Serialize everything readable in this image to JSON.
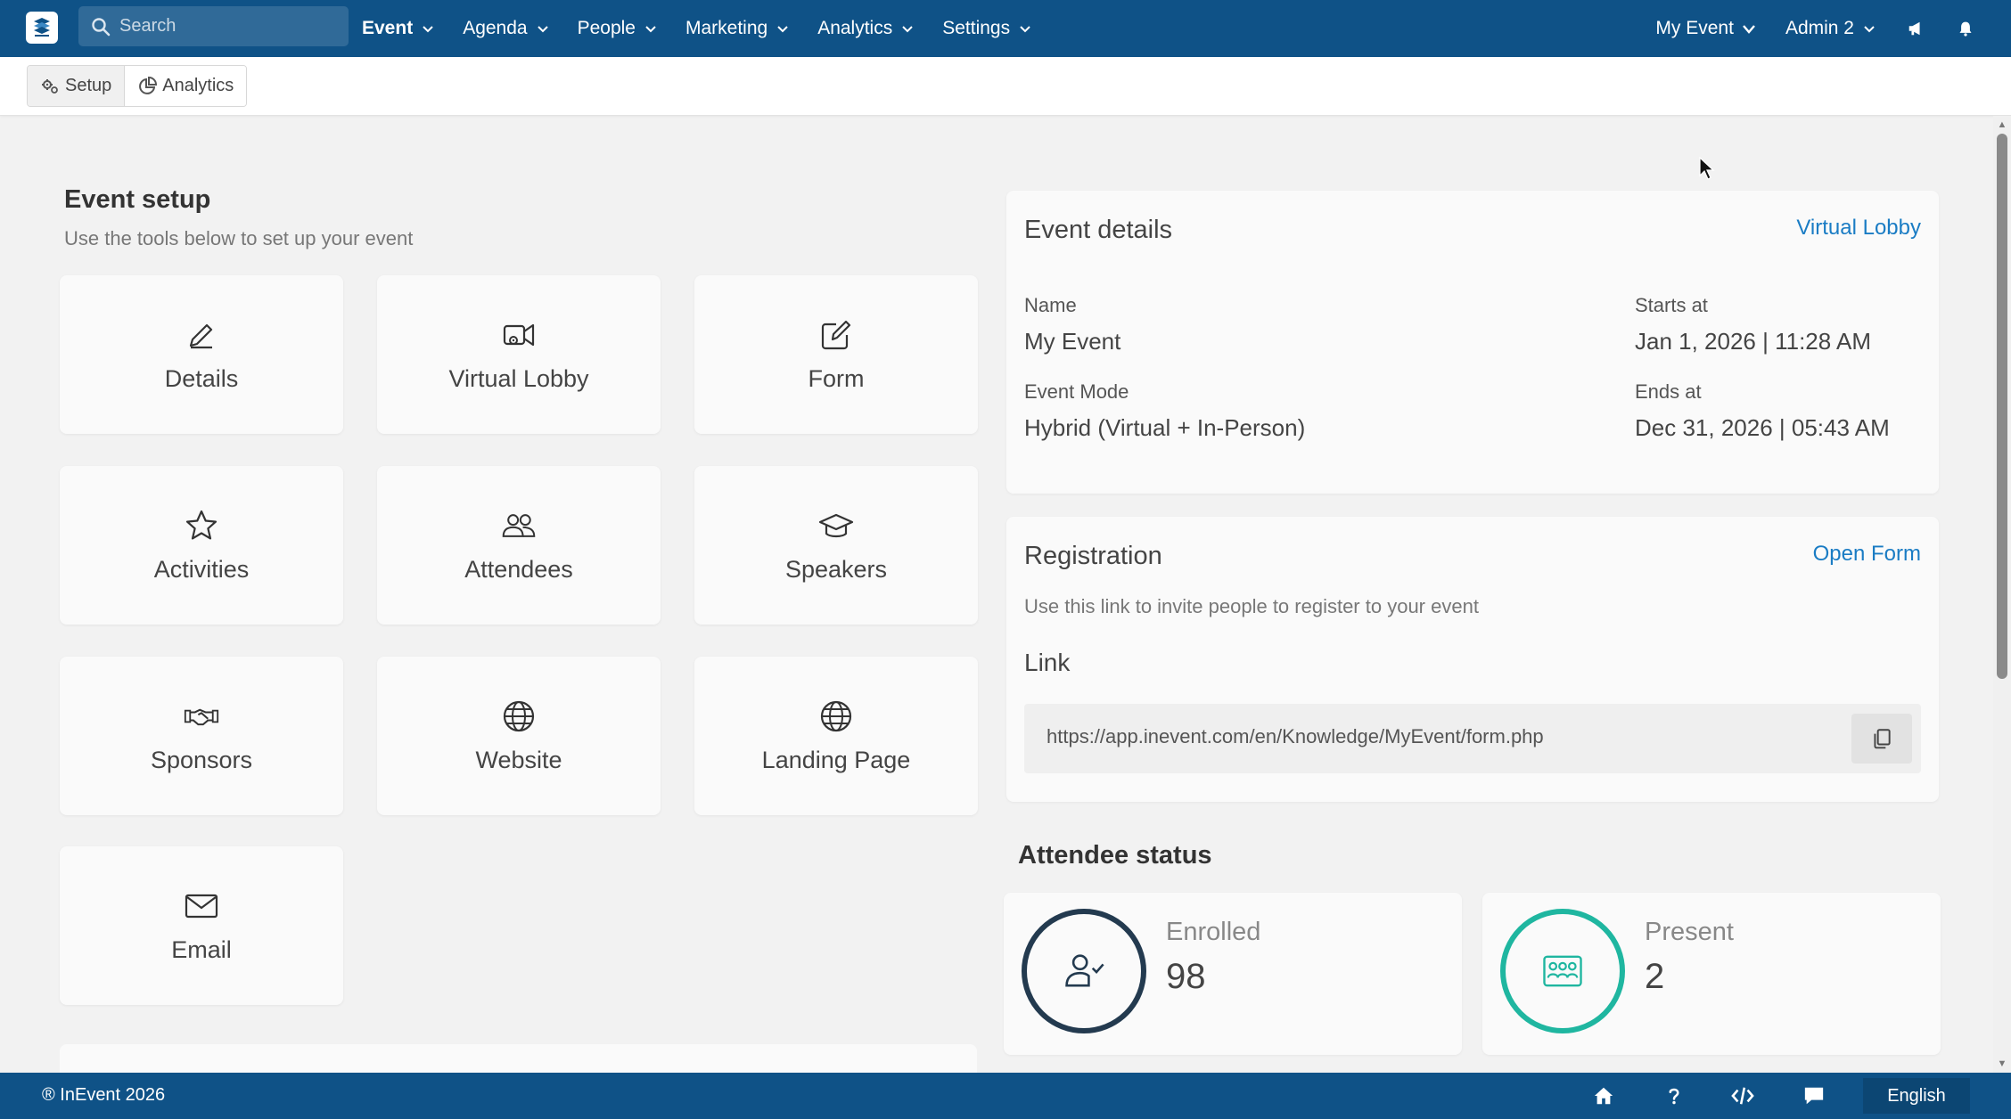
{
  "nav": {
    "search_placeholder": "Search",
    "items": [
      {
        "label": "Event",
        "active": true
      },
      {
        "label": "Agenda"
      },
      {
        "label": "People"
      },
      {
        "label": "Marketing"
      },
      {
        "label": "Analytics"
      },
      {
        "label": "Settings"
      }
    ],
    "right": {
      "event_label": "My Event",
      "user_label": "Admin 2"
    },
    "icons": [
      "megaphone-icon",
      "bell-icon"
    ]
  },
  "subnav": {
    "tabs": [
      {
        "label": "Setup",
        "active": true
      },
      {
        "label": "Analytics"
      }
    ]
  },
  "event_setup": {
    "title": "Event setup",
    "subtitle": "Use the tools below to set up your event",
    "tiles": [
      {
        "label": "Details",
        "icon": "pencil-icon"
      },
      {
        "label": "Virtual Lobby",
        "icon": "video-camera-icon"
      },
      {
        "label": "Form",
        "icon": "edit-square-icon"
      },
      {
        "label": "Activities",
        "icon": "star-icon"
      },
      {
        "label": "Attendees",
        "icon": "users-icon"
      },
      {
        "label": "Speakers",
        "icon": "graduation-cap-icon"
      },
      {
        "label": "Sponsors",
        "icon": "handshake-icon"
      },
      {
        "label": "Website",
        "icon": "globe-icon"
      },
      {
        "label": "Landing Page",
        "icon": "globe-icon"
      },
      {
        "label": "Email",
        "icon": "envelope-icon"
      }
    ]
  },
  "event_details": {
    "title": "Event details",
    "link": "Virtual Lobby",
    "name_label": "Name",
    "name_value": "My Event",
    "starts_label": "Starts at",
    "starts_value": "Jan 1, 2026 | 11:28 AM",
    "mode_label": "Event Mode",
    "mode_value": "Hybrid (Virtual + In-Person)",
    "ends_label": "Ends at",
    "ends_value": "Dec 31, 2026 | 05:43 AM"
  },
  "registration": {
    "title": "Registration",
    "link": "Open Form",
    "description": "Use this link to invite people to register to your event",
    "link_title": "Link",
    "url": "https://app.inevent.com/en/Knowledge/MyEvent/form.php"
  },
  "attendee_status": {
    "title": "Attendee status",
    "enrolled": {
      "label": "Enrolled",
      "value": "98",
      "color": "#233a4f"
    },
    "present": {
      "label": "Present",
      "value": "2",
      "color": "#1fb6a0"
    }
  },
  "footer": {
    "copyright": "® InEvent 2026",
    "language": "English",
    "icons": [
      "home-icon",
      "help-icon",
      "code-icon",
      "chat-icon"
    ]
  },
  "colors": {
    "primary": "#0f5287",
    "accent_link": "#1a7cc4",
    "teal": "#1fb6a0"
  }
}
